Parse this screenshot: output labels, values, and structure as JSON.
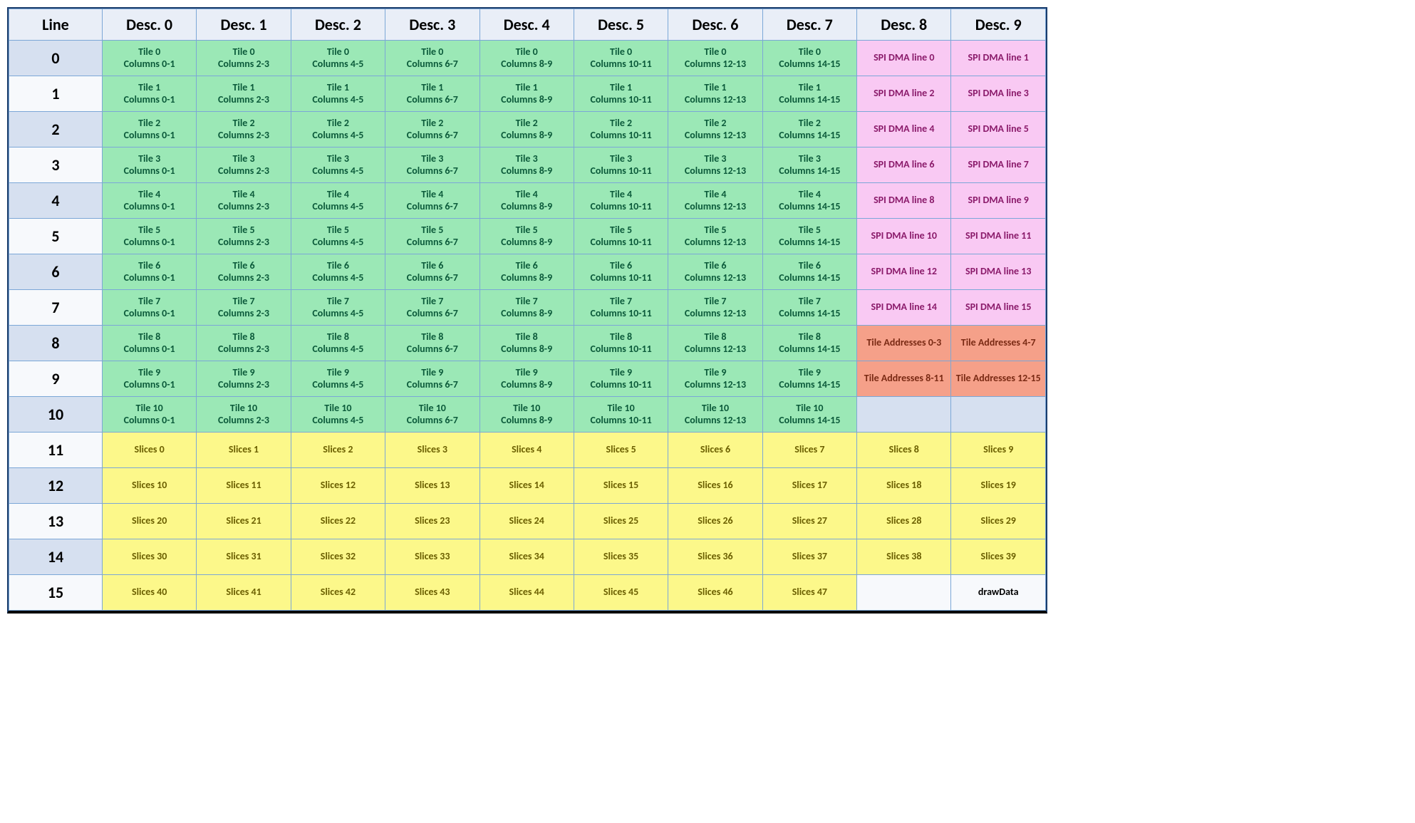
{
  "headers": [
    "Line",
    "Desc. 0",
    "Desc. 1",
    "Desc. 2",
    "Desc. 3",
    "Desc. 4",
    "Desc. 5",
    "Desc. 6",
    "Desc. 7",
    "Desc. 8",
    "Desc. 9"
  ],
  "colRanges": [
    "0-1",
    "2-3",
    "4-5",
    "6-7",
    "8-9",
    "10-11",
    "12-13",
    "14-15"
  ],
  "rows": [
    {
      "line": 0,
      "tiles": 0,
      "extra": [
        {
          "k": "pink",
          "t": "SPI DMA line 0"
        },
        {
          "k": "pink",
          "t": "SPI DMA line 1"
        }
      ]
    },
    {
      "line": 1,
      "tiles": 1,
      "extra": [
        {
          "k": "pink",
          "t": "SPI DMA line 2"
        },
        {
          "k": "pink",
          "t": "SPI DMA line 3"
        }
      ]
    },
    {
      "line": 2,
      "tiles": 2,
      "extra": [
        {
          "k": "pink",
          "t": "SPI DMA line 4"
        },
        {
          "k": "pink",
          "t": "SPI DMA line 5"
        }
      ]
    },
    {
      "line": 3,
      "tiles": 3,
      "extra": [
        {
          "k": "pink",
          "t": "SPI DMA line 6"
        },
        {
          "k": "pink",
          "t": "SPI DMA line 7"
        }
      ]
    },
    {
      "line": 4,
      "tiles": 4,
      "extra": [
        {
          "k": "pink",
          "t": "SPI DMA line 8"
        },
        {
          "k": "pink",
          "t": "SPI DMA line 9"
        }
      ]
    },
    {
      "line": 5,
      "tiles": 5,
      "extra": [
        {
          "k": "pink",
          "t": "SPI DMA line 10"
        },
        {
          "k": "pink",
          "t": "SPI DMA line 11"
        }
      ]
    },
    {
      "line": 6,
      "tiles": 6,
      "extra": [
        {
          "k": "pink",
          "t": "SPI DMA line 12"
        },
        {
          "k": "pink",
          "t": "SPI DMA line 13"
        }
      ]
    },
    {
      "line": 7,
      "tiles": 7,
      "extra": [
        {
          "k": "pink",
          "t": "SPI DMA line 14"
        },
        {
          "k": "pink",
          "t": "SPI DMA line 15"
        }
      ]
    },
    {
      "line": 8,
      "tiles": 8,
      "extra": [
        {
          "k": "salmon",
          "t": "Tile Addresses 0-3"
        },
        {
          "k": "salmon",
          "t": "Tile Addresses 4-7"
        }
      ]
    },
    {
      "line": 9,
      "tiles": 9,
      "extra": [
        {
          "k": "salmon",
          "t": "Tile Addresses 8-11"
        },
        {
          "k": "salmon",
          "t": "Tile Addresses 12-15"
        }
      ]
    },
    {
      "line": 10,
      "tiles": 10,
      "extra": [
        {
          "k": "empty",
          "t": ""
        },
        {
          "k": "empty",
          "t": ""
        }
      ]
    },
    {
      "line": 11,
      "slicesStart": 0
    },
    {
      "line": 12,
      "slicesStart": 10
    },
    {
      "line": 13,
      "slicesStart": 20
    },
    {
      "line": 14,
      "slicesStart": 30
    },
    {
      "line": 15,
      "slicesStart": 40,
      "slicesCount": 8,
      "extra": [
        {
          "k": "empty",
          "t": ""
        },
        {
          "k": "drawdata",
          "t": "drawData"
        }
      ]
    }
  ],
  "labels": {
    "tilePrefix": "Tile ",
    "columnsPrefix": "Columns ",
    "slicesPrefix": "Slices "
  }
}
